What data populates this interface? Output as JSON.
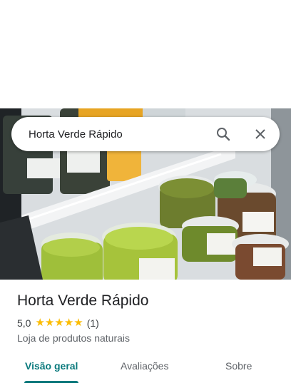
{
  "search": {
    "query": "Horta Verde Rápido",
    "search_icon": "search-icon",
    "close_icon": "close-icon"
  },
  "place": {
    "name": "Horta Verde Rápido",
    "rating": "5,0",
    "stars": 5,
    "reviews": "(1)",
    "category": "Loja de produtos naturais"
  },
  "tabs": [
    {
      "label": "Visão geral",
      "active": true
    },
    {
      "label": "Avaliações",
      "active": false
    },
    {
      "label": "Sobre",
      "active": false
    }
  ],
  "colors": {
    "accent": "#0b7a7d",
    "star": "#fbbc04"
  }
}
